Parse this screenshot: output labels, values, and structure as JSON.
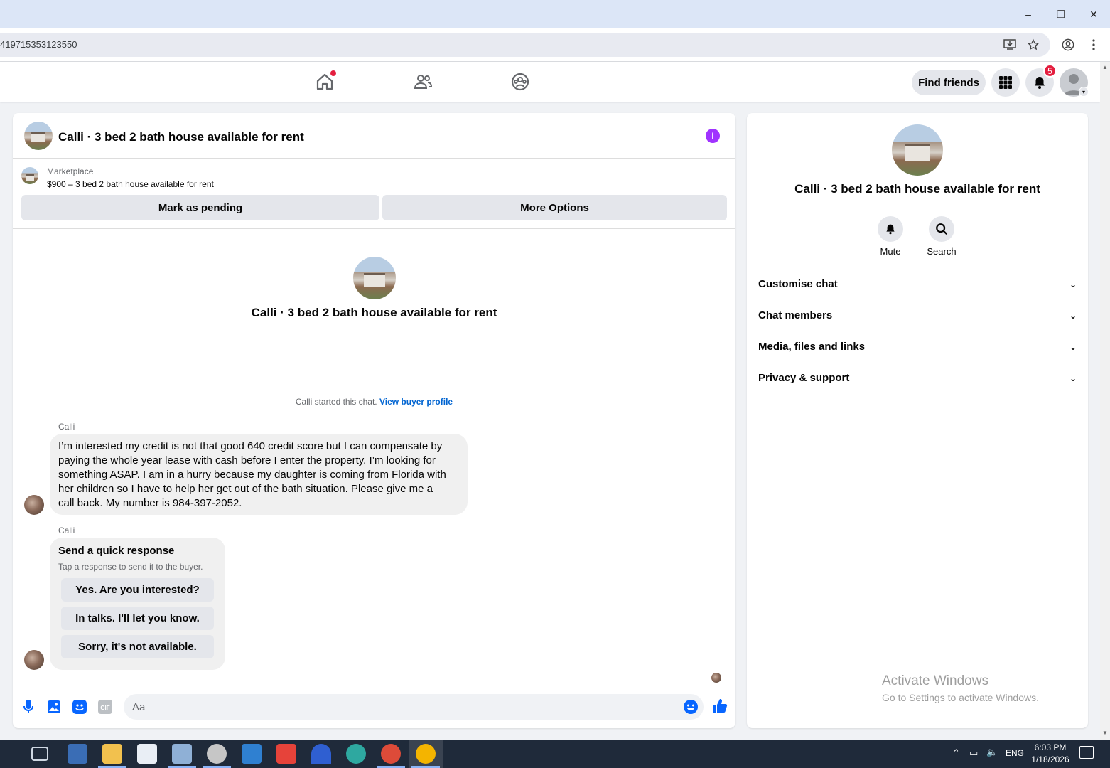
{
  "browser": {
    "url_fragment": "419715353123550",
    "window_controls": {
      "minimize": "–",
      "restore": "❐",
      "close": "✕"
    }
  },
  "fb_nav": {
    "find_friends": "Find friends",
    "notification_count": "5"
  },
  "chat": {
    "title": "Calli · 3 bed 2 bath house available for rent",
    "marketplace_label": "Marketplace",
    "listing": "$900 – 3 bed 2 bath house available for rent",
    "mark_pending": "Mark as pending",
    "more_options": "More Options",
    "intro_title": "Calli · 3 bed 2 bath house available for rent",
    "started_text": "Calli started this chat. ",
    "view_buyer_profile": "View buyer profile",
    "messages": [
      {
        "sender": "Calli",
        "lines": [
          "I’m interested my credit is not that good 640 credit score but I can compensate by",
          "paying the whole year lease with cash before I enter the property. I’m looking for",
          "something ASAP. I am in a hurry because my daughter is coming from Florida with",
          "her children so I have to  help her get out of the bath situation. Please give me a",
          "call back. My number is 984-397-2052."
        ]
      },
      {
        "sender": "Calli",
        "quick_title": "Send a quick response",
        "quick_sub": "Tap a response to send it to the buyer.",
        "options": [
          "Yes. Are you interested?",
          "In talks. I'll let you know.",
          "Sorry, it's not available."
        ]
      }
    ],
    "input_placeholder": "Aa"
  },
  "side": {
    "title": "Calli · 3 bed 2 bath house available for rent",
    "actions": [
      {
        "label": "Mute",
        "icon": "bell-icon"
      },
      {
        "label": "Search",
        "icon": "search-icon"
      }
    ],
    "sections": [
      "Customise chat",
      "Chat members",
      "Media, files and links",
      "Privacy & support"
    ]
  },
  "watermark": {
    "line1": "Activate Windows",
    "line2": "Go to Settings to activate Windows."
  },
  "taskbar": {
    "lang": "ENG",
    "time": "6:03 PM",
    "date": "1/18/2026"
  },
  "colors": {
    "accent": "#0866ff",
    "info": "#a033ff",
    "badge": "#e41e3f"
  }
}
